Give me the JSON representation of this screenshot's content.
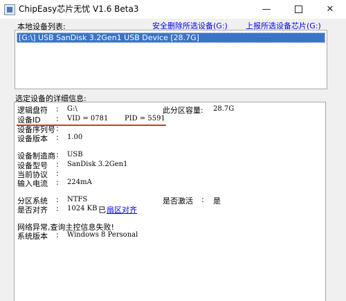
{
  "window": {
    "title": "ChipEasy芯片无忧 V1.6 Beta3",
    "minimize": "—",
    "close": "✕"
  },
  "links": {
    "safe_remove": "安全删除所选设备(G:)",
    "report_chip": "上报所选设备芯片(G:)"
  },
  "device_list": {
    "label": "本地设备列表:",
    "items": [
      "[G:\\] USB  SanDisk 3.2Gen1 USB Device [28.7G]"
    ]
  },
  "details": {
    "label": "选定设备的详细信息:",
    "drive_letter": {
      "key": "逻辑盘符",
      "sep": ":",
      "value": "G:\\"
    },
    "partition_capacity": {
      "key": "此分区容量:",
      "value": "28.7G"
    },
    "device_id": {
      "key": "设备ID",
      "sep": ":",
      "vid": "VID = 0781",
      "pid": "PID = 5591"
    },
    "serial": {
      "key": "设备序列号",
      "sep": ":",
      "value": ""
    },
    "version": {
      "key": "设备版本",
      "sep": ":",
      "value": "1.00"
    },
    "vendor": {
      "key": "设备制造商",
      "sep": ":",
      "value": "USB"
    },
    "model": {
      "key": "设备型号",
      "sep": ":",
      "value": "SanDisk 3.2Gen1"
    },
    "protocol": {
      "key": "当前协议",
      "sep": ":",
      "value": ""
    },
    "current": {
      "key": "输入电流",
      "sep": ":",
      "value": "224mA"
    },
    "filesystem": {
      "key": "分区系统",
      "sep": ":",
      "value": "NTFS"
    },
    "activated": {
      "key": "是否激活",
      "sep": ":",
      "value": "是"
    },
    "aligned": {
      "key": "是否对齐",
      "sep": ":",
      "value": "1024 KB",
      "status": "已",
      "link": "扇区对齐"
    },
    "network_error": "网络异常,查询主控信息失败!",
    "os": {
      "key": "系统版本",
      "sep": ":",
      "value": "Windows 8 Personal"
    }
  },
  "colors": {
    "selection": "#3b73c8",
    "link": "#0000ee",
    "underline_mark": "#d9342a"
  }
}
